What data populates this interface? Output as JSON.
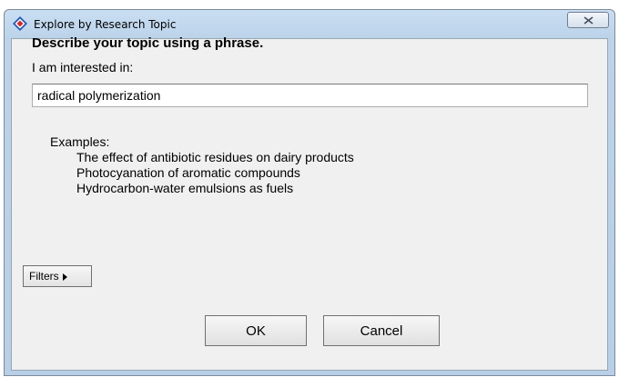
{
  "window": {
    "title": "Explore by Research Topic",
    "icon": "diamond-app-icon",
    "close_icon": "close-icon"
  },
  "form": {
    "heading": "Describe your topic using a phrase.",
    "label": "I am interested in:",
    "topic_value": "radical polymerization"
  },
  "examples": {
    "title": "Examples:",
    "items": [
      "The effect of antibiotic residues on dairy products",
      "Photocyanation of aromatic compounds",
      "Hydrocarbon-water emulsions as fuels"
    ]
  },
  "buttons": {
    "filters_label": "Filters",
    "ok_label": "OK",
    "cancel_label": "Cancel"
  },
  "colors": {
    "frame": "#b7cfe7",
    "client": "#f0f0f0",
    "icon_blue": "#1e5bb8",
    "icon_red": "#d8282a"
  }
}
